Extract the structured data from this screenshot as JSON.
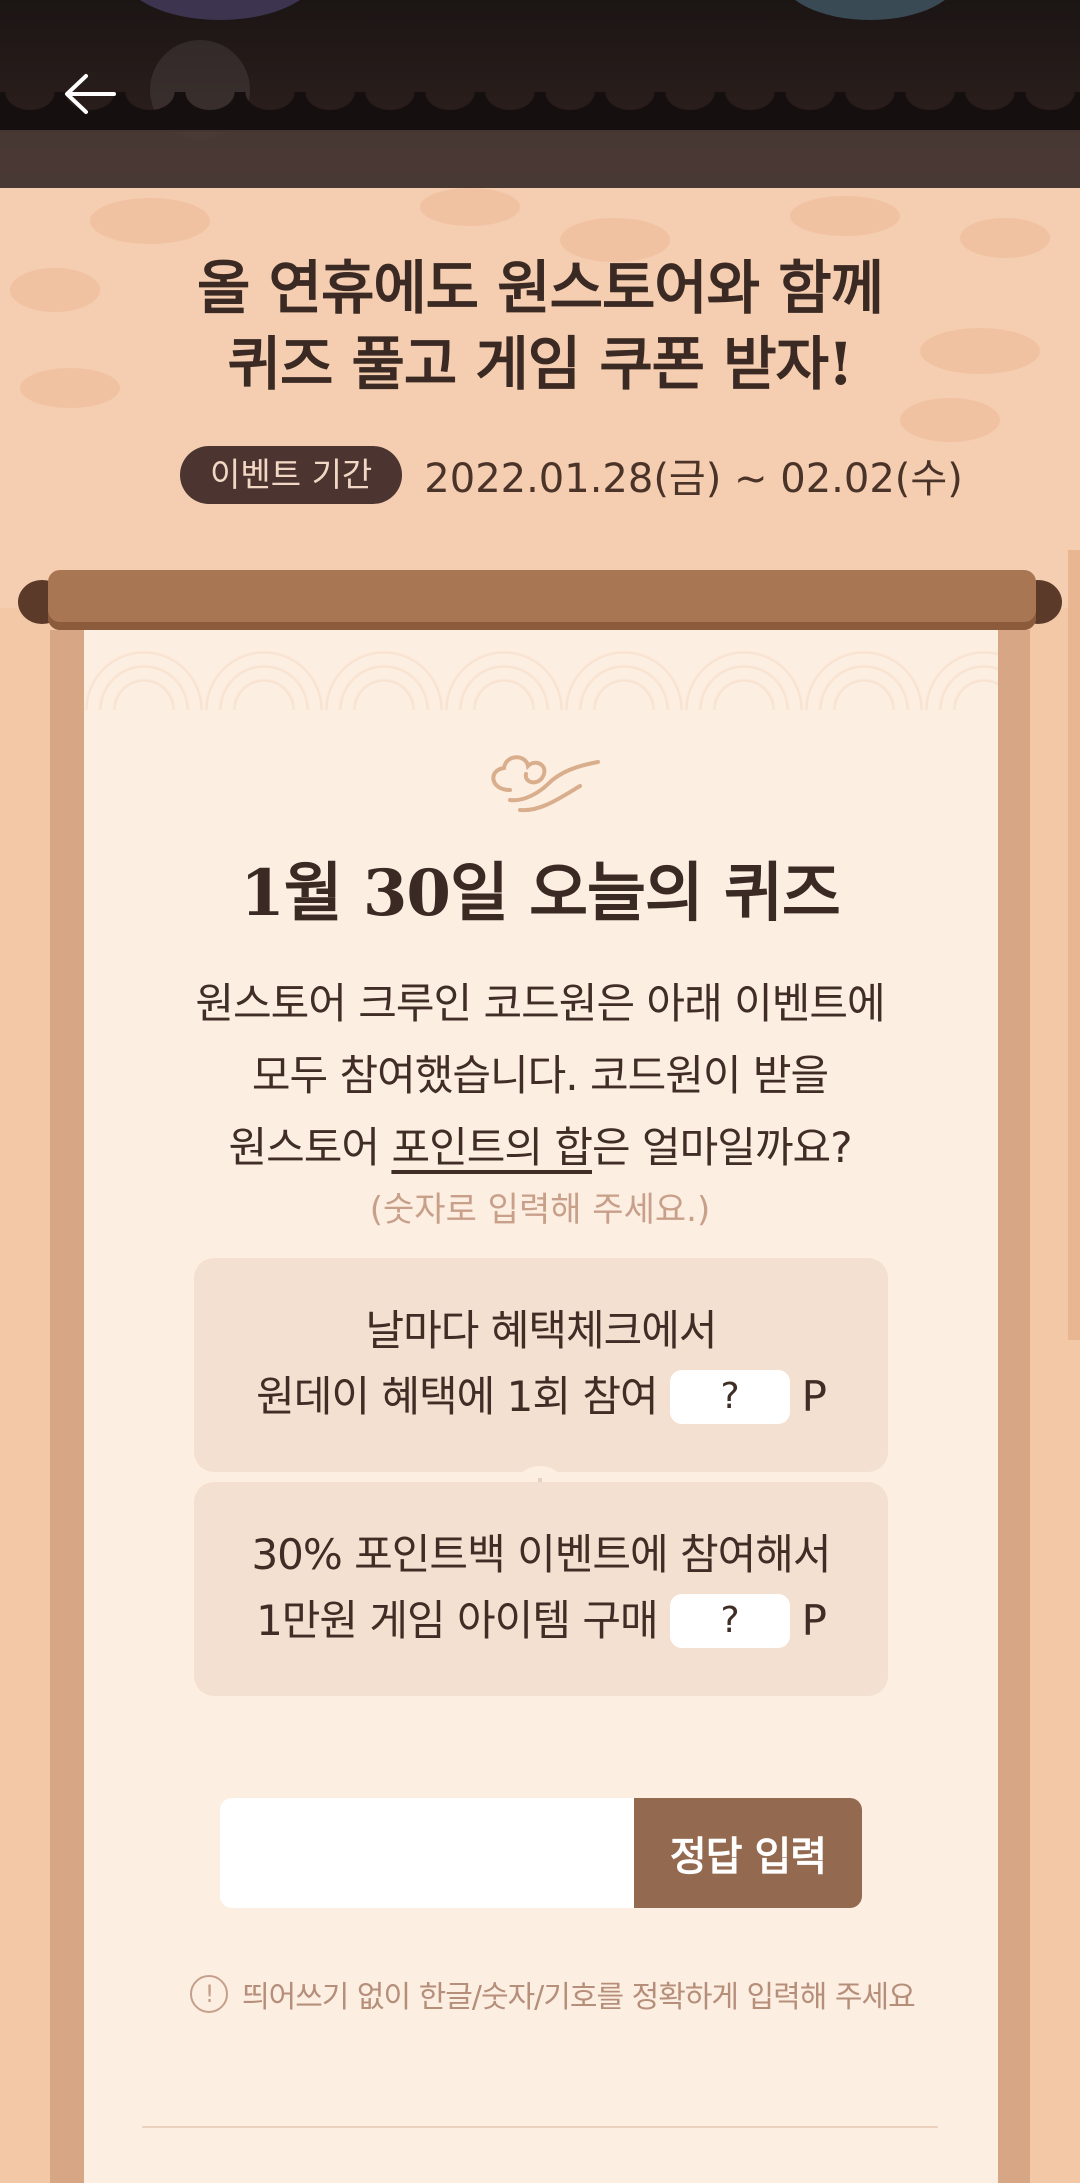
{
  "header": {
    "back_label": "←"
  },
  "event": {
    "title_line1": "올 연휴에도 원스토어와 함께",
    "title_line2": "퀴즈 풀고 게임 쿠폰 받자!",
    "period_label": "이벤트 기간",
    "period_value": "2022.01.28(금) ~ 02.02(수)"
  },
  "quiz": {
    "title": "1월 30일 오늘의 퀴즈",
    "question_line1": "원스토어 크루인 코드원은 아래 이벤트에",
    "question_line2": "모두 참여했습니다. 코드원이 받을",
    "question_line3_pre": "원스토어 ",
    "question_line3_underline": "포인트의 합",
    "question_line3_post": "은 얼마일까요?",
    "hint": "(숫자로 입력해 주세요.)",
    "items": [
      {
        "line1": "날마다 혜택체크에서",
        "line2": "원데이 혜택에 1회 참여",
        "blank": "?",
        "unit": "P"
      },
      {
        "line1": "30% 포인트백 이벤트에 참여해서",
        "line2": "1만원 게임 아이템 구매",
        "blank": "?",
        "unit": "P"
      }
    ],
    "answer_placeholder": "",
    "answer_button": "정답 입력",
    "notice": "띄어쓰기 없이 한글/숫자/기호를 정확하게 입력해 주세요",
    "notice_icon": "!"
  },
  "colors": {
    "background": "#f2c8a6",
    "paper": "#fdeee2",
    "button": "#936a4f",
    "badge": "#4c3530"
  }
}
